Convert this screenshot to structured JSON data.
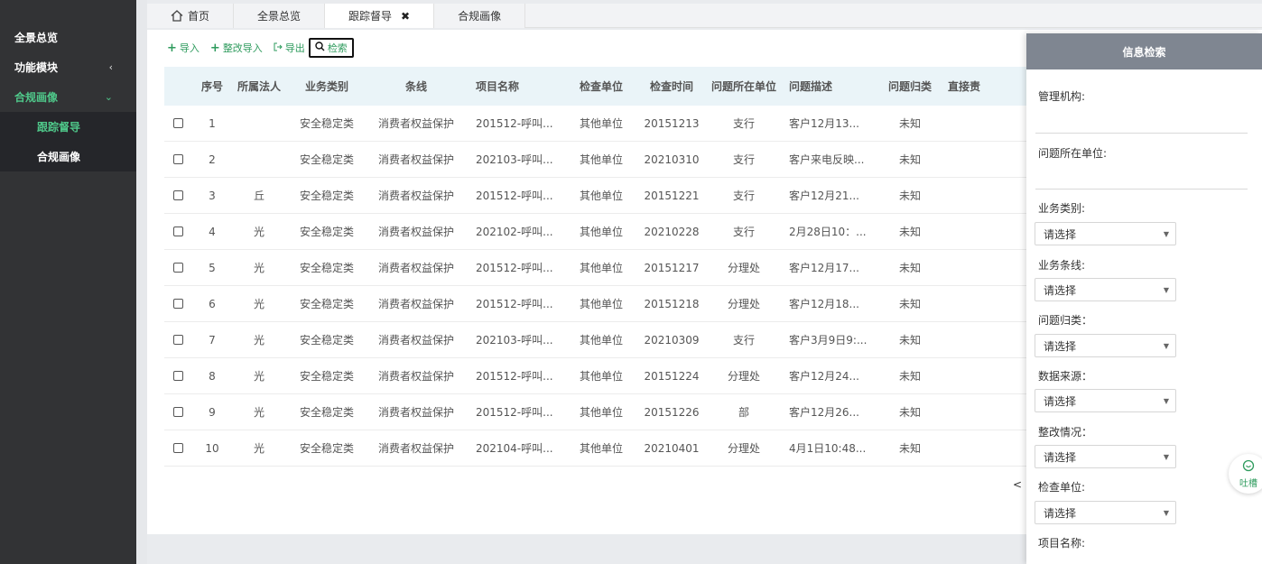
{
  "sidebar": {
    "items": [
      {
        "label": "全景总览"
      },
      {
        "label": "功能模块",
        "arrow": "‹"
      },
      {
        "label": "合规画像",
        "arrow": "⌄"
      }
    ],
    "subitems": [
      {
        "label": "跟踪督导"
      },
      {
        "label": "合规画像"
      }
    ]
  },
  "tabs": [
    {
      "label": "首页",
      "icon": "home-icon"
    },
    {
      "label": "全景总览"
    },
    {
      "label": "跟踪督导",
      "close": "✖"
    },
    {
      "label": "合规画像"
    }
  ],
  "toolbar": {
    "import_label": "导入",
    "rectify_import_label": "整改导入",
    "export_label": "导出",
    "search_label": "检索"
  },
  "table": {
    "headers": [
      "序号",
      "所属法人",
      "业务类别",
      "条线",
      "项目名称",
      "检查单位",
      "检查时间",
      "问题所在单位",
      "问题描述",
      "问题归类",
      "直接责"
    ],
    "rows": [
      [
        "1",
        "",
        "安全稳定类",
        "消费者权益保护",
        "201512-呼叫...",
        "其他单位",
        "20151213",
        "支行",
        "客户12月13...",
        "未知"
      ],
      [
        "2",
        "",
        "安全稳定类",
        "消费者权益保护",
        "202103-呼叫...",
        "其他单位",
        "20210310",
        "支行",
        "客户来电反映...",
        "未知"
      ],
      [
        "3",
        "丘",
        "安全稳定类",
        "消费者权益保护",
        "201512-呼叫...",
        "其他单位",
        "20151221",
        "支行",
        "客户12月21...",
        "未知"
      ],
      [
        "4",
        "光",
        "安全稳定类",
        "消费者权益保护",
        "202102-呼叫...",
        "其他单位",
        "20210228",
        "支行",
        "2月28日10：...",
        "未知"
      ],
      [
        "5",
        "光",
        "安全稳定类",
        "消费者权益保护",
        "201512-呼叫...",
        "其他单位",
        "20151217",
        "分理处",
        "客户12月17...",
        "未知"
      ],
      [
        "6",
        "光",
        "安全稳定类",
        "消费者权益保护",
        "201512-呼叫...",
        "其他单位",
        "20151218",
        "分理处",
        "客户12月18...",
        "未知"
      ],
      [
        "7",
        "光",
        "安全稳定类",
        "消费者权益保护",
        "202103-呼叫...",
        "其他单位",
        "20210309",
        "支行",
        "客户3月9日9:...",
        "未知"
      ],
      [
        "8",
        "光",
        "安全稳定类",
        "消费者权益保护",
        "201512-呼叫...",
        "其他单位",
        "20151224",
        "分理处",
        "客户12月24...",
        "未知"
      ],
      [
        "9",
        "光",
        "安全稳定类",
        "消费者权益保护",
        "201512-呼叫...",
        "其他单位",
        "20151226",
        "部",
        "客户12月26...",
        "未知"
      ],
      [
        "10",
        "光",
        "安全稳定类",
        "消费者权益保护",
        "202104-呼叫...",
        "其他单位",
        "20210401",
        "分理处",
        "4月1日10:48...",
        "未知"
      ]
    ]
  },
  "pager": {
    "prev": "<"
  },
  "panel": {
    "title": "信息检索",
    "fields": {
      "org": "管理机构:",
      "issue_unit": "问题所在单位:",
      "biz_type": "业务类别:",
      "biz_line": "业务条线:",
      "issue_cat": "问题归类：",
      "data_source": "数据来源：",
      "rectify": "整改情况：",
      "check_unit": "检查单位:",
      "project": "项目名称:"
    },
    "select_placeholder": "请选择"
  },
  "float_button": {
    "label": "吐槽"
  },
  "colors": {
    "accent": "#2e9b5d",
    "active_menu": "#4fc88a",
    "sidebar": "#323335",
    "panel_header": "#7f8691"
  }
}
